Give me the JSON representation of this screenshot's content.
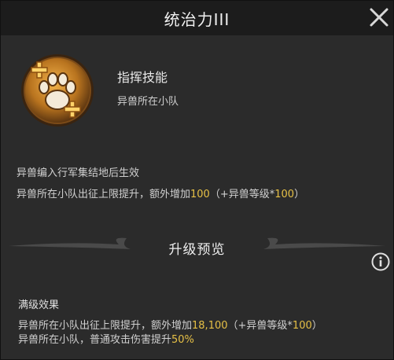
{
  "header": {
    "title": "统治力III"
  },
  "skill": {
    "name": "指挥技能",
    "target": "异兽所在小队",
    "icon": "paw-plus-icon"
  },
  "effect": {
    "condition": "异兽编入行军集结地后生效",
    "line_prefix": "异兽所在小队出征上限提升，额外增加",
    "line_value": "100",
    "line_bonus_open": "（+异兽等级*",
    "line_bonus_value": "100",
    "line_bonus_close": "）"
  },
  "preview": {
    "title": "升级预览"
  },
  "max_level": {
    "title": "满级效果",
    "line1_prefix": "异兽所在小队出征上限提升，额外增加",
    "line1_value": "18,100",
    "line1_bonus_open": "（+异兽等级*",
    "line1_bonus_value": "100",
    "line1_bonus_close": "）",
    "line2_prefix": "异兽所在小队，普通攻击伤害提升",
    "line2_value": "50%"
  },
  "colors": {
    "highlight": "#e6c046",
    "icon_gold": "#c98a2a",
    "background": "#2b2b2b"
  }
}
